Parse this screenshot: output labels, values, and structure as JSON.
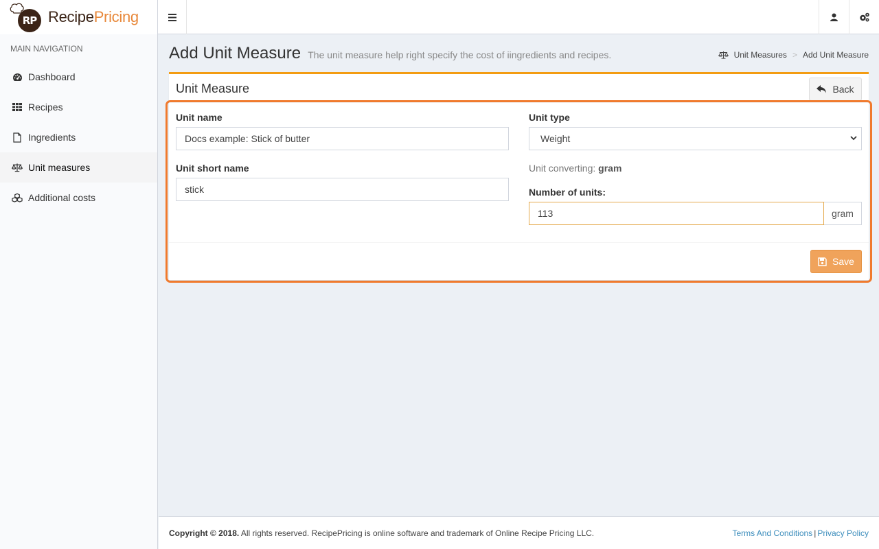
{
  "brand": {
    "initials": "RP",
    "name_part1": "Recipe",
    "name_part2": "Pricing"
  },
  "sidebar": {
    "header": "MAIN NAVIGATION",
    "items": [
      {
        "label": "Dashboard",
        "icon": "dashboard-icon"
      },
      {
        "label": "Recipes",
        "icon": "grid-icon"
      },
      {
        "label": "Ingredients",
        "icon": "file-icon"
      },
      {
        "label": "Unit measures",
        "icon": "balance-scale-icon",
        "active": true
      },
      {
        "label": "Additional costs",
        "icon": "cubes-icon"
      }
    ]
  },
  "topbar": {
    "icons": [
      "menu-icon",
      "user-icon",
      "cogs-icon"
    ]
  },
  "header": {
    "title": "Add Unit Measure",
    "subtitle": "The unit measure help right specify the cost of iingredients and recipes.",
    "breadcrumb": [
      "Unit Measures",
      "Add Unit Measure"
    ]
  },
  "box": {
    "title": "Unit Measure",
    "back_label": "Back",
    "save_label": "Save"
  },
  "form": {
    "unit_name_label": "Unit name",
    "unit_name_value": "Docs example: Stick of butter",
    "unit_short_name_label": "Unit short name",
    "unit_short_name_value": "stick",
    "unit_type_label": "Unit type",
    "unit_type_value": "Weight",
    "unit_converting_label": "Unit converting:",
    "unit_converting_value": "gram",
    "number_of_units_label": "Number of units:",
    "number_of_units_value": "113",
    "number_of_units_addon": "gram"
  },
  "footer": {
    "copyright": "Copyright © 2018.",
    "text": "All rights reserved. RecipePricing is online software and trademark of Online Recipe Pricing LLC.",
    "links": [
      "Terms And Conditions",
      "Privacy Policy"
    ],
    "separator": "|"
  },
  "colors": {
    "accent": "#f39c12",
    "highlight": "#f07a2d",
    "save": "#f0a35b",
    "link": "#3c8dbc",
    "brand_dark": "#3b2417",
    "brand_orange": "#e8883a"
  }
}
